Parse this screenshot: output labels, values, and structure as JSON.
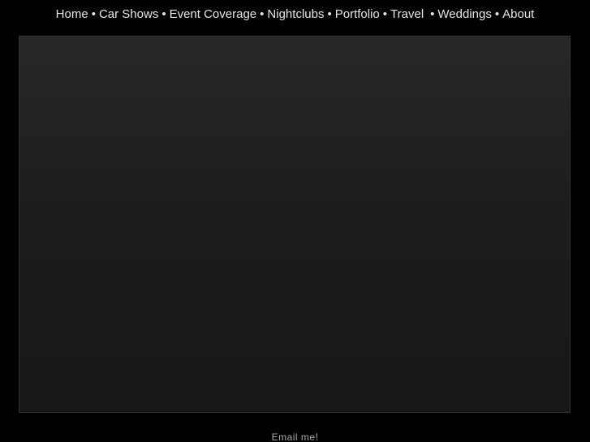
{
  "nav": {
    "items": [
      {
        "label": "Home"
      },
      {
        "label": "Car Shows"
      },
      {
        "label": "Event Coverage"
      },
      {
        "label": "Nightclubs"
      },
      {
        "label": "Portfolio"
      },
      {
        "label": "Travel"
      },
      {
        "label": "Weddings"
      },
      {
        "label": "About"
      }
    ],
    "separator": "•"
  },
  "footer": {
    "email_label": "Email me!"
  }
}
